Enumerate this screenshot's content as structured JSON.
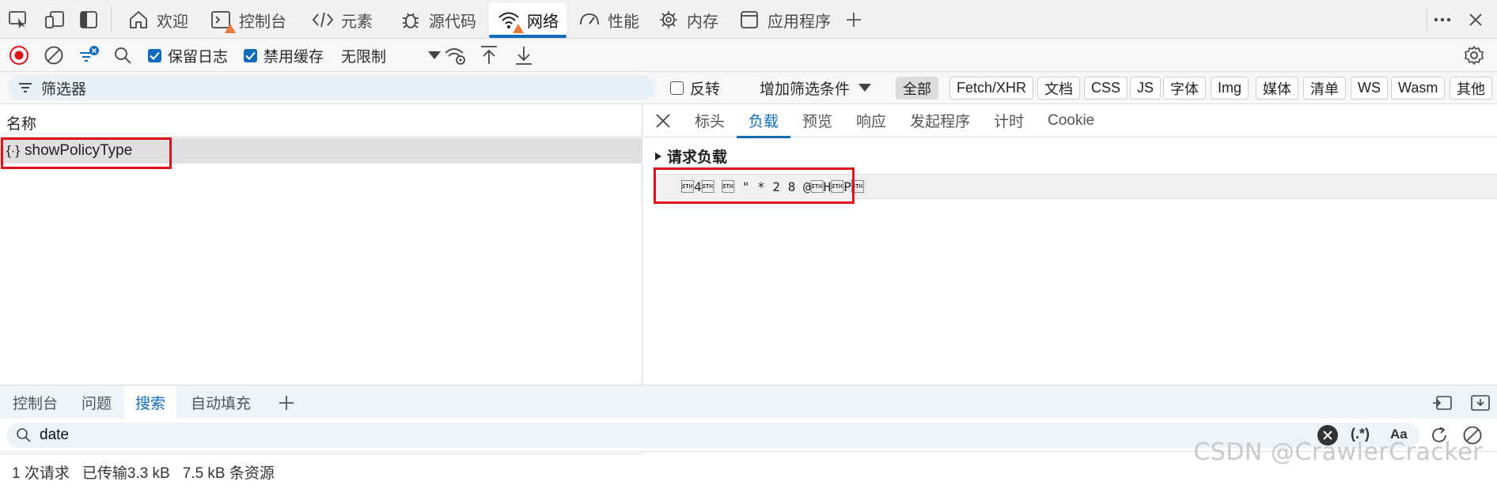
{
  "top_tabs": [
    {
      "label": "欢迎",
      "icon": "home-icon"
    },
    {
      "label": "控制台",
      "icon": "console-icon",
      "warning": true
    },
    {
      "label": "元素",
      "icon": "code-icon"
    },
    {
      "label": "源代码",
      "icon": "bug-icon"
    },
    {
      "label": "网络",
      "icon": "wifi-icon",
      "warning": true,
      "active": true
    },
    {
      "label": "性能",
      "icon": "gauge-icon"
    },
    {
      "label": "内存",
      "icon": "chip-icon"
    },
    {
      "label": "应用程序",
      "icon": "app-window-icon"
    }
  ],
  "toolbar": {
    "preserve_log": "保留日志",
    "disable_cache": "禁用缓存",
    "throttling": "无限制"
  },
  "filter": {
    "placeholder": "筛选器",
    "invert": "反转",
    "more_filters": "增加筛选条件",
    "chips": [
      "全部",
      "Fetch/XHR",
      "文档",
      "CSS",
      "JS",
      "字体",
      "Img",
      "媒体",
      "清单",
      "WS",
      "Wasm",
      "其他"
    ]
  },
  "request_list": {
    "column_name": "名称",
    "rows": [
      {
        "icon": "{·}",
        "name": "showPolicyType"
      }
    ],
    "status": {
      "requests": "1 次请求",
      "transferred": "已传输3.3 kB",
      "resources": "7.5 kB 条资源"
    }
  },
  "detail": {
    "tabs": [
      "标头",
      "负载",
      "预览",
      "响应",
      "发起程序",
      "计时",
      "Cookie"
    ],
    "active_tab": "负载",
    "section_title": "请求负载",
    "payload_text": "\u00024\u0002 \u0002 \" * 2 8 @\u0002H\u0002P\u0002"
  },
  "drawer": {
    "tabs": [
      "控制台",
      "问题",
      "搜索",
      "自动填充"
    ],
    "active_tab": "搜索",
    "search_value": "date",
    "regex_label": "(.*)",
    "case_label": "Aa"
  },
  "watermark": "CSDN @CrawlerCracker",
  "colors": {
    "accent": "#0f6cbd",
    "highlight": "#e0101a",
    "record": "#e0101a",
    "warning": "#e8793a"
  }
}
